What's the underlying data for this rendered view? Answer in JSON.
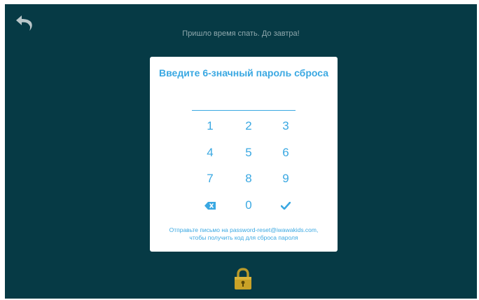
{
  "header": {
    "back_icon": "back-arrow-icon",
    "message": "Пришло время спать. До завтра!"
  },
  "dialog": {
    "title": "Введите 6-значный пароль сброса",
    "password_value": "",
    "keypad": {
      "k1": "1",
      "k2": "2",
      "k3": "3",
      "k4": "4",
      "k5": "5",
      "k6": "6",
      "k7": "7",
      "k8": "8",
      "k9": "9",
      "k0": "0",
      "backspace_icon": "backspace-icon",
      "confirm_icon": "checkmark-icon"
    },
    "hint_line1": "Отправьте письмо на password-reset@iwawakids.com,",
    "hint_line2": "чтобы получить код для сброса пароля"
  },
  "footer": {
    "lock_icon": "padlock-icon"
  },
  "colors": {
    "background": "#063a45",
    "accent": "#3aa8e2",
    "message_text": "#8fa8ad",
    "lock_gold": "#c9a227"
  }
}
